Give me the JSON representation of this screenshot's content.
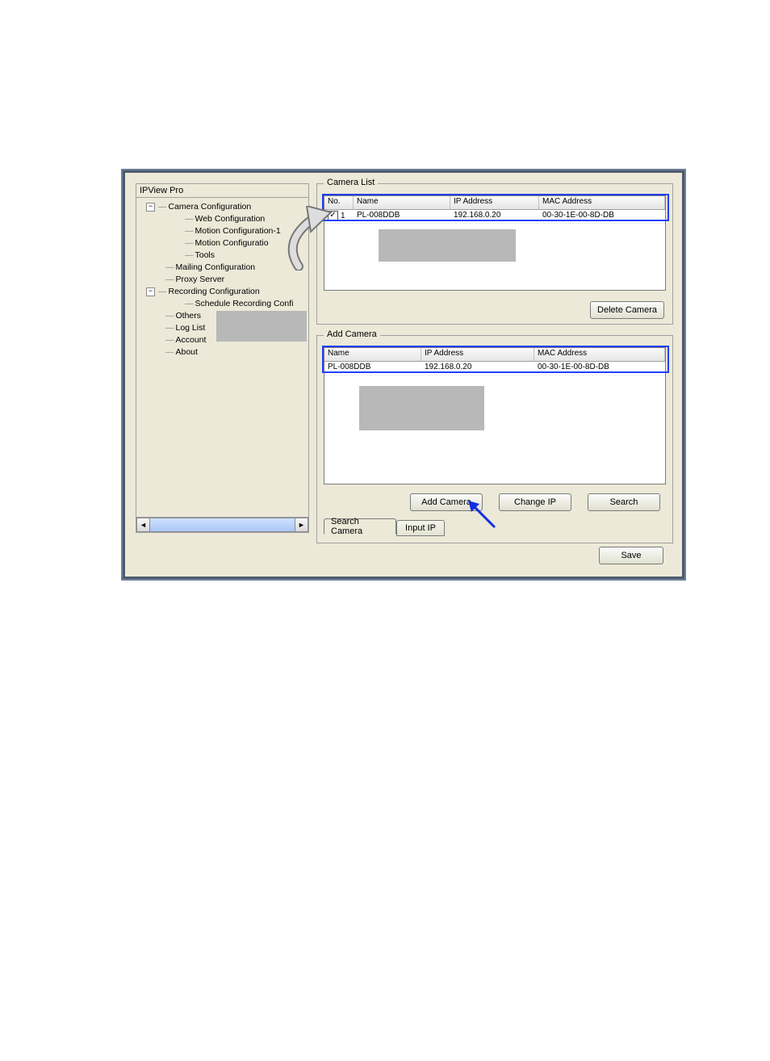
{
  "tree": {
    "header": "IPView Pro",
    "items": [
      "Camera Configuration",
      "Web Configuration",
      "Motion Configuration-1",
      "Motion Configuratio",
      "Tools",
      "Mailing Configuration",
      "Proxy Server",
      "Recording Configuration",
      "Schedule Recording Confi",
      "Others",
      "Log List",
      "Account",
      "About"
    ]
  },
  "cameraList": {
    "title": "Camera List",
    "headers": {
      "no": "No.",
      "name": "Name",
      "ip": "IP Address",
      "mac": "MAC Address"
    },
    "row": {
      "no": "1",
      "name": "PL-008DDB",
      "ip": "192.168.0.20",
      "mac": "00-30-1E-00-8D-DB"
    },
    "deleteBtn": "Delete Camera"
  },
  "addCamera": {
    "title": "Add Camera",
    "headers": {
      "name": "Name",
      "ip": "IP Address",
      "mac": "MAC Address"
    },
    "row": {
      "name": "PL-008DDB",
      "ip": "192.168.0.20",
      "mac": "00-30-1E-00-8D-DB"
    },
    "addBtn": "Add Camera",
    "changeIpBtn": "Change IP",
    "searchBtn": "Search",
    "tabSearch": "Search Camera",
    "tabInput": "Input IP"
  },
  "saveBtn": "Save"
}
